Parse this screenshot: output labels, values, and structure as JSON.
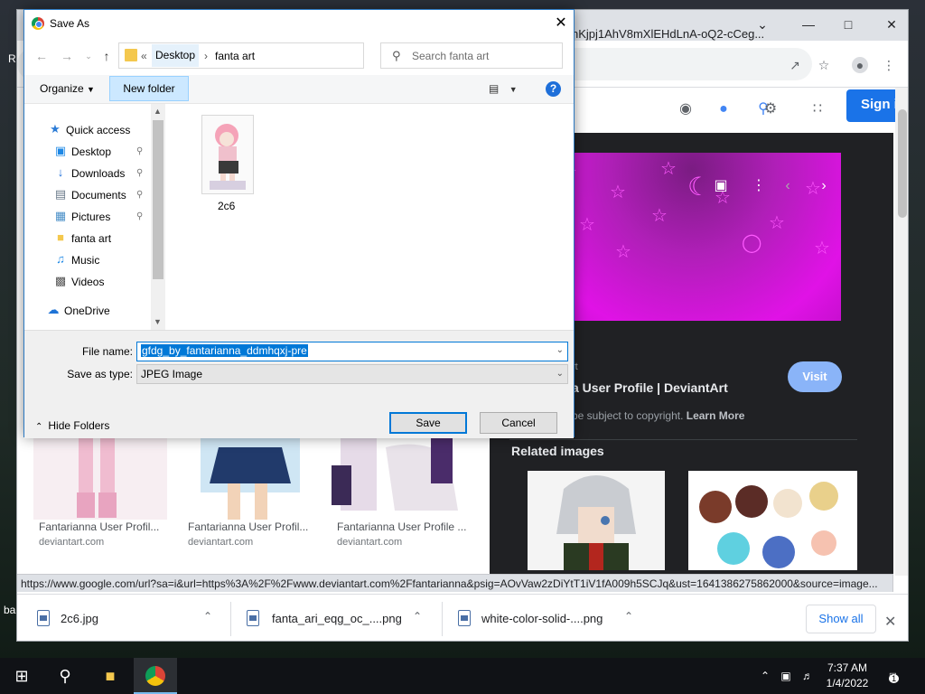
{
  "desktop": {
    "fragments": [
      "R",
      "ba"
    ]
  },
  "chrome": {
    "url_fragment": "nKjpj1AhV8mXlEHdLnA-oQ2-cCeg...",
    "signin_label": "Sign i",
    "status_url": "https://www.google.com/url?sa=i&url=https%3A%2F%2Fwww.deviantart.com%2Ffantarianna&psig=AOvVaw2zDiYtT1iV1fA009h5SCJq&ust=1641386275862000&source=image...",
    "panel": {
      "source_fragment": "rt",
      "title_fragment": "a User Profile | DeviantArt",
      "copyright_text": "be subject to copyright.",
      "learn_more": "Learn More",
      "visit_label": "Visit",
      "related_heading": "Related images"
    },
    "cards": [
      {
        "title": "Fantarianna User Profil...",
        "source": "deviantart.com"
      },
      {
        "title": "Fantarianna User Profil...",
        "source": "deviantart.com"
      },
      {
        "title": "Fantarianna User Profile ...",
        "source": "deviantart.com"
      }
    ],
    "downloads": [
      {
        "name": "2c6.jpg"
      },
      {
        "name": "fanta_ari_eqg_oc_....png"
      },
      {
        "name": "white-color-solid-....png"
      }
    ],
    "show_all_label": "Show all"
  },
  "dialog": {
    "title": "Save As",
    "breadcrumb": {
      "overflow": "«",
      "segments": [
        "Desktop",
        "fanta art"
      ]
    },
    "search_placeholder": "Search fanta art",
    "organize_label": "Organize",
    "new_folder_label": "New folder",
    "nav_items": [
      {
        "label": "Quick access",
        "icon": "star-icon"
      },
      {
        "label": "Desktop",
        "icon": "desktop-icon",
        "pinned": true
      },
      {
        "label": "Downloads",
        "icon": "download-icon",
        "pinned": true
      },
      {
        "label": "Documents",
        "icon": "document-icon",
        "pinned": true
      },
      {
        "label": "Pictures",
        "icon": "pictures-icon",
        "pinned": true
      },
      {
        "label": "fanta art",
        "icon": "folder-icon"
      },
      {
        "label": "Music",
        "icon": "music-icon"
      },
      {
        "label": "Videos",
        "icon": "video-icon"
      },
      {
        "label": "OneDrive",
        "icon": "cloud-icon"
      }
    ],
    "files": [
      {
        "name": "2c6"
      }
    ],
    "file_name_label": "File name:",
    "file_name_value": "gfdg_by_fantarianna_ddmhqxj-pre",
    "save_as_type_label": "Save as type:",
    "save_as_type_value": "JPEG Image",
    "hide_folders_label": "Hide Folders",
    "save_label": "Save",
    "cancel_label": "Cancel"
  },
  "taskbar": {
    "time": "7:37 AM",
    "date": "1/4/2022",
    "notification_count": "1"
  },
  "colors": {
    "accent": "#0078d7",
    "google_blue": "#1a73e8",
    "panel_dark": "#202124",
    "hero_magenta": "#e012e6"
  }
}
